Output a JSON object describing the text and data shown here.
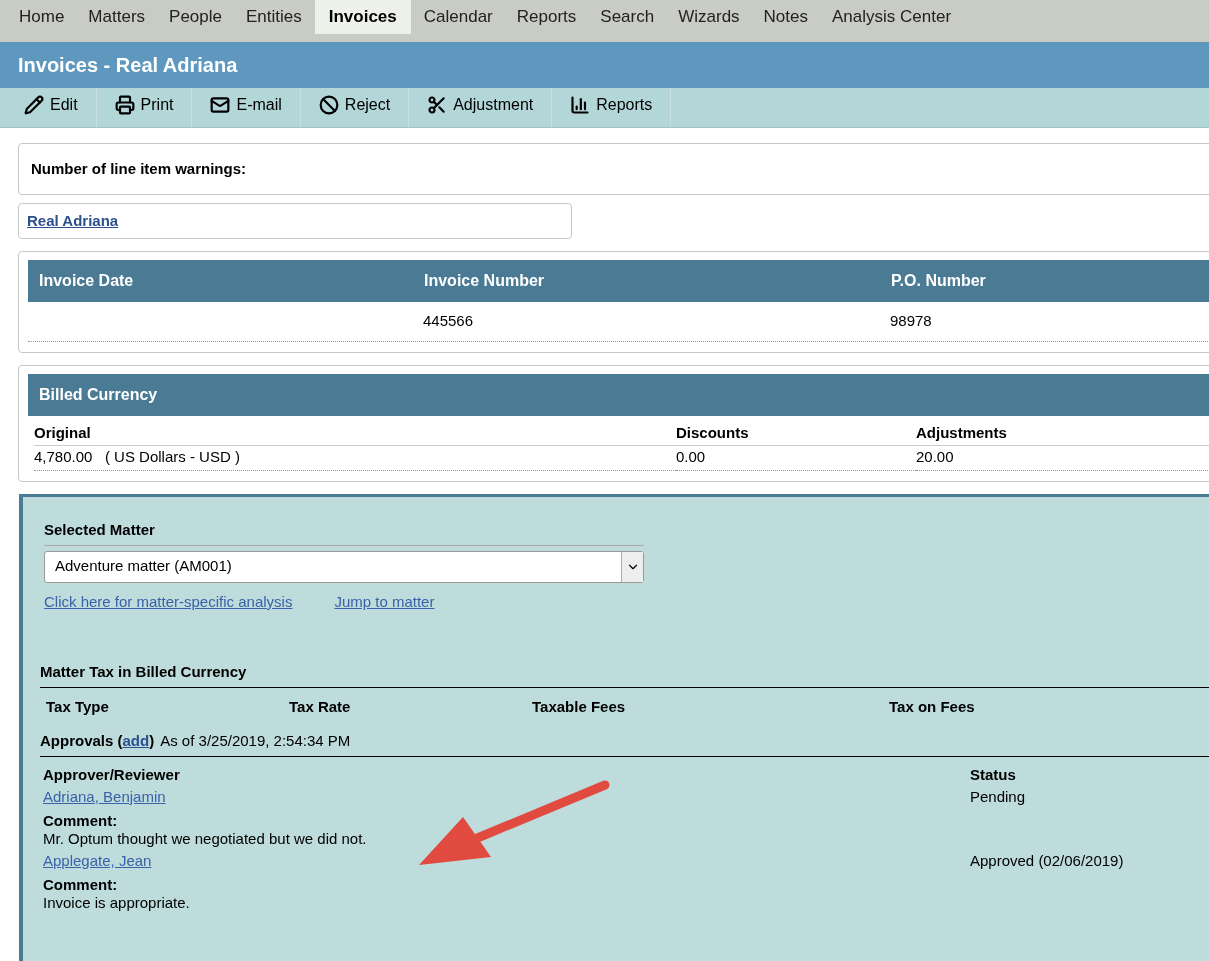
{
  "nav_tabs": [
    {
      "label": "Home",
      "selected": false
    },
    {
      "label": "Matters",
      "selected": false
    },
    {
      "label": "People",
      "selected": false
    },
    {
      "label": "Entities",
      "selected": false
    },
    {
      "label": "Invoices",
      "selected": true
    },
    {
      "label": "Calendar",
      "selected": false
    },
    {
      "label": "Reports",
      "selected": false
    },
    {
      "label": "Search",
      "selected": false
    },
    {
      "label": "Wizards",
      "selected": false
    },
    {
      "label": "Notes",
      "selected": false
    },
    {
      "label": "Analysis Center",
      "selected": false
    }
  ],
  "page_title": "Invoices - Real Adriana",
  "toolbar": [
    {
      "label": "Edit",
      "kind": "pencil"
    },
    {
      "label": "Print",
      "kind": "printer"
    },
    {
      "label": "E-mail",
      "kind": "envelope"
    },
    {
      "label": "Reject",
      "kind": "ban"
    },
    {
      "label": "Adjustment",
      "kind": "scissors"
    },
    {
      "label": "Reports",
      "kind": "chart"
    }
  ],
  "warnings_label": "Number of line item warnings:",
  "vendor_link": "Real Adriana",
  "invoice_table": {
    "columns": [
      "Invoice Date",
      "Invoice Number",
      "P.O. Number"
    ],
    "row": {
      "invoice_number": "445566",
      "po_number": "98978"
    }
  },
  "billed_currency": {
    "title": "Billed Currency",
    "columns": [
      "Original",
      "Discounts",
      "Adjustments"
    ],
    "row": [
      "4,780.00   ( US Dollars - USD )",
      "0.00",
      "20.00"
    ]
  },
  "matter": {
    "label": "Selected Matter",
    "value": "Adventure matter (AM001)",
    "links": [
      "Click here for matter-specific analysis",
      "Jump to matter"
    ]
  },
  "tax": {
    "title": "Matter Tax in Billed Currency",
    "columns": [
      "Tax Type",
      "Tax Rate",
      "Taxable Fees",
      "Tax on Fees"
    ]
  },
  "approvals": {
    "title": "Approvals (",
    "add_link": "add",
    "title_end": ")",
    "as_of": "As of 3/25/2019, 2:54:34 PM",
    "columns": [
      "Approver/Reviewer",
      "Status"
    ],
    "rows": [
      {
        "name": "Adriana, Benjamin",
        "status": "Pending",
        "comment_label": "Comment:",
        "comment": "Mr. Optum thought we negotiated but we did not."
      },
      {
        "name": "Applegate, Jean",
        "status": "Approved (02/06/2019)",
        "comment_label": "Comment:",
        "comment": "Invoice is appropriate."
      }
    ]
  }
}
